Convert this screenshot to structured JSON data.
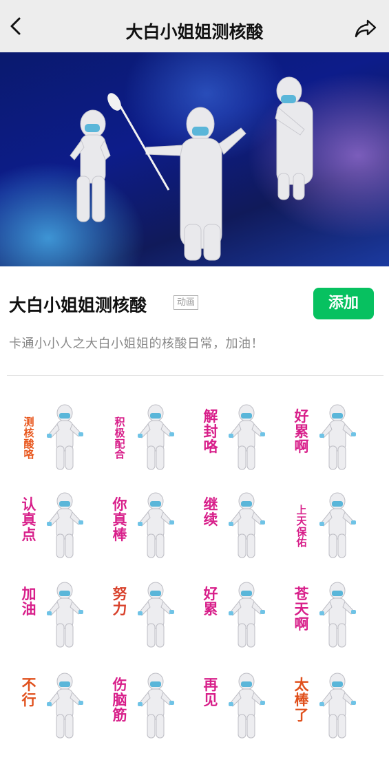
{
  "header": {
    "title": "大白小姐姐测核酸",
    "back_icon": "chevron-left-icon",
    "share_icon": "share-icon"
  },
  "info": {
    "name": "大白小姐姐测核酸",
    "badge": "动画",
    "add_label": "添加",
    "description": "卡通小小人之大白小姐姐的核酸日常，加油！",
    "accent": "#07c160"
  },
  "stickers": [
    {
      "caption": "测核酸咯",
      "color": "#e8561c"
    },
    {
      "caption": "积极配合",
      "color": "#d81f8a"
    },
    {
      "caption": "解封咯",
      "color": "#d81f8a"
    },
    {
      "caption": "好累啊",
      "color": "#d81f8a"
    },
    {
      "caption": "认真点",
      "color": "#d81f8a"
    },
    {
      "caption": "你真棒",
      "color": "#d81f8a"
    },
    {
      "caption": "继续",
      "color": "#d81f8a"
    },
    {
      "caption": "上天保佑",
      "color": "#d81f8a"
    },
    {
      "caption": "加油",
      "color": "#d81f8a"
    },
    {
      "caption": "努力",
      "color": "#d8402a"
    },
    {
      "caption": "好累",
      "color": "#d81f8a"
    },
    {
      "caption": "苍天啊",
      "color": "#d81f8a"
    },
    {
      "caption": "不行",
      "color": "#e0501c"
    },
    {
      "caption": "伤脑筋",
      "color": "#d81f8a"
    },
    {
      "caption": "再见",
      "color": "#d81f8a"
    },
    {
      "caption": "太棒了",
      "color": "#e0501c"
    }
  ]
}
